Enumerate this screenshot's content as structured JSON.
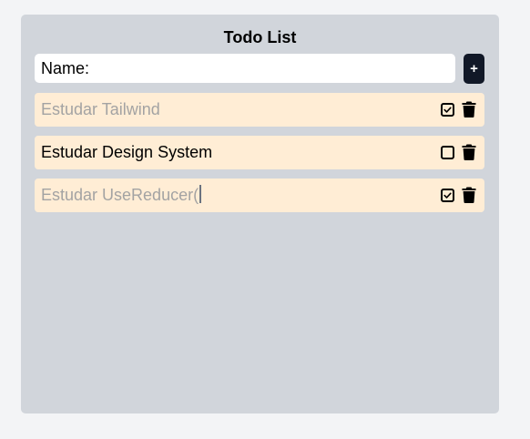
{
  "app": {
    "title": "Todo List"
  },
  "form": {
    "input_value": "Name:",
    "add_label": "+"
  },
  "todos": [
    {
      "text": "Estudar Tailwind",
      "done": true,
      "icons": [
        "checked-box-icon",
        "trash-icon"
      ]
    },
    {
      "text": "Estudar Design System",
      "done": false,
      "icons": [
        "empty-checkbox-icon",
        "trash-icon"
      ]
    },
    {
      "text": "Estudar UseReducer(",
      "done": true,
      "icons": [
        "checked-box-icon",
        "trash-icon"
      ]
    }
  ],
  "colors": {
    "page_bg": "#f3f4f6",
    "card_bg": "#d1d5db",
    "item_bg": "#ffedd5",
    "button_bg": "#111827",
    "done_text": "#a3a3a3"
  }
}
